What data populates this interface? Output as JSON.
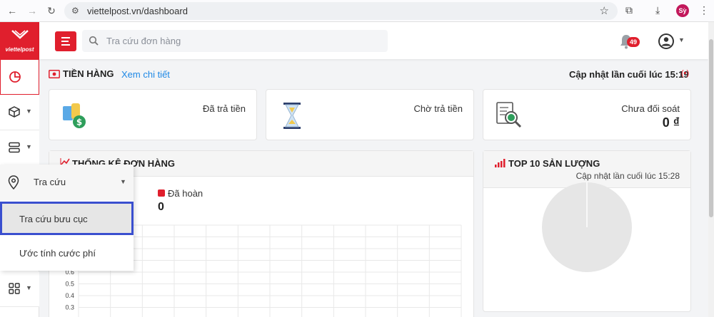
{
  "browser": {
    "url": "viettelpost.vn/dashboard",
    "profile_initial": "Sỳ"
  },
  "brand": {
    "logo_text": "viettelpost",
    "accent_color": "#e01f2d",
    "highlight_border_color": "#3a4fcf"
  },
  "sidebar": {
    "items": [
      {
        "icon": "pie-chart-icon"
      },
      {
        "icon": "package-icon"
      },
      {
        "icon": "server-icon"
      },
      {
        "icon": "location-pin-icon"
      },
      {
        "icon": "apps-grid-icon"
      }
    ]
  },
  "flyout": {
    "title": "Tra cứu",
    "items": [
      "Tra cứu bưu cục",
      "Ước tính cước phí"
    ]
  },
  "header": {
    "search_placeholder": "Tra cứu đơn hàng",
    "notification_count": "49"
  },
  "money": {
    "title": "TIỀN HÀNG",
    "link": "Xem chi tiết",
    "updated": "Cập nhật lần cuối lúc 15:19",
    "cards": [
      {
        "label": "Đã trả tiền",
        "value": ""
      },
      {
        "label": "Chờ trả tiền",
        "value": ""
      },
      {
        "label": "Chưa đối soát",
        "value": "0 ₫"
      }
    ]
  },
  "orders": {
    "title": "THỐNG KÊ ĐƠN HÀNG",
    "legend_label": "Đã hoàn",
    "legend_value": "0"
  },
  "chart_data": {
    "type": "line",
    "series": [
      {
        "name": "Đã hoàn",
        "values": []
      }
    ],
    "y_tick_labels": [
      "0.6",
      "0.5",
      "0.4",
      "0.3"
    ],
    "grid": true
  },
  "top10": {
    "title": "TOP 10 SẢN LƯỢNG",
    "updated": "Cập nhật lần cuối lúc 15:28"
  }
}
